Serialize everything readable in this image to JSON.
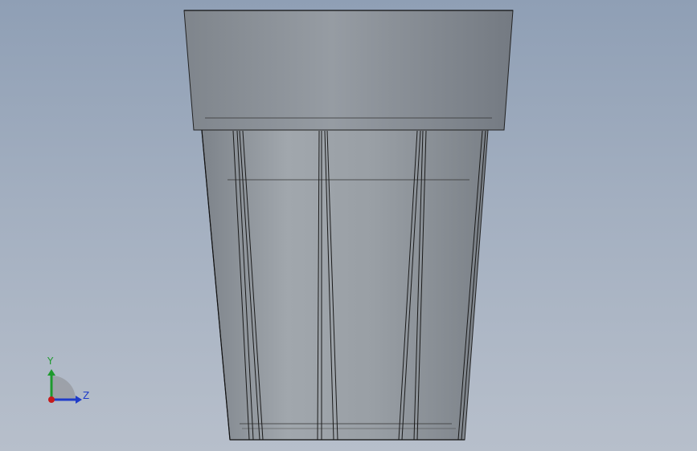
{
  "viewport": {
    "background_top": "#8f9fb5",
    "background_bottom": "#b7bfcb"
  },
  "model": {
    "part": "tapered-cup-with-collar",
    "rim_color": "#8e959c",
    "body_color": "#9aa0a6",
    "edge_color": "#1a1a1a"
  },
  "triad": {
    "y_label": "Y",
    "z_label": "Z",
    "y_color": "#1e9a2e",
    "z_color": "#1f3cc9",
    "x_color": "#c61b1b"
  }
}
